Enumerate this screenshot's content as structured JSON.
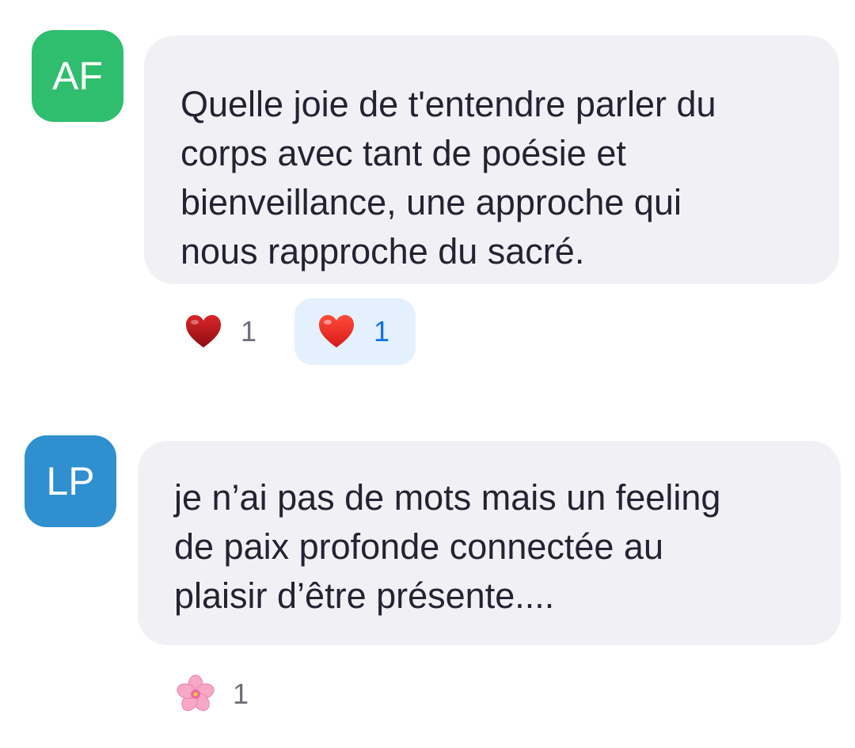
{
  "messages": [
    {
      "avatar": {
        "initials": "AF",
        "color": "#2fbd6e"
      },
      "text_lines": [
        "Quelle joie de t'entendre parler du",
        "corps avec tant de poésie et",
        "bienveillance, une approche qui",
        "nous rapproche du sacré."
      ],
      "reactions": [
        {
          "emoji": "heart-dark-red-icon",
          "count": "1",
          "selected": false
        },
        {
          "emoji": "heart-red-icon",
          "count": "1",
          "selected": true
        }
      ]
    },
    {
      "avatar": {
        "initials": "LP",
        "color": "#2f8fcf"
      },
      "text_lines": [
        "je n’ai pas de mots mais un feeling",
        "de paix profonde connectée au",
        "plaisir d’être présente...."
      ],
      "reactions": [
        {
          "emoji": "cherry-blossom-icon",
          "count": "1",
          "selected": false
        }
      ]
    }
  ],
  "colors": {
    "bubble_bg": "#f1f1f5",
    "text": "#232333",
    "reaction_selected_bg": "#e4f0fd",
    "reaction_selected_count": "#0e71eb",
    "reaction_count": "#6e6e7a"
  }
}
